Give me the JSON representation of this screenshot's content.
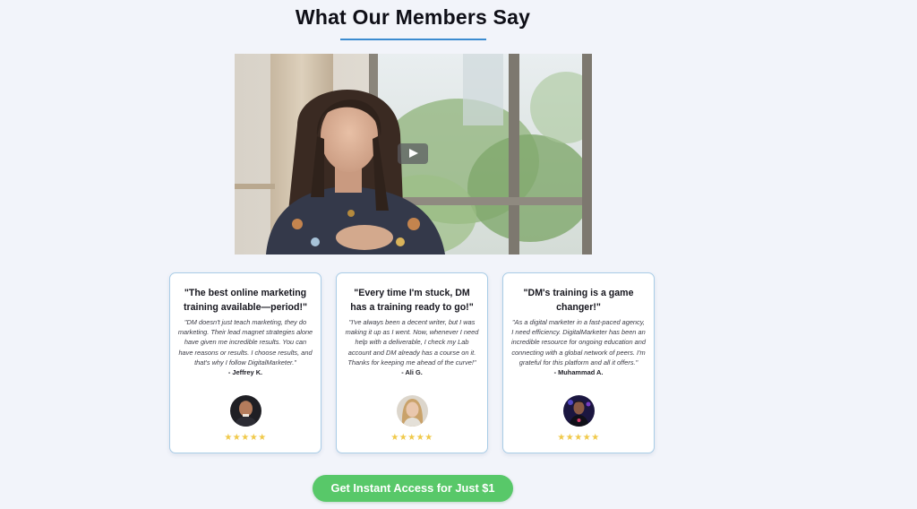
{
  "section": {
    "title": "What Our Members Say"
  },
  "video": {
    "play_icon": "play-icon"
  },
  "testimonials": [
    {
      "headline": "\"The best online marketing training available—period!\"",
      "quote": "\"DM doesn't just teach marketing, they do marketing. Their lead magnet strategies alone have given me incredible results. You can have reasons or results. I choose results, and that's why I follow DigitalMarketer.\"",
      "author": "- Jeffrey K.",
      "stars": "★★★★★",
      "rating": 5
    },
    {
      "headline": "\"Every time I'm stuck, DM has a training ready to go!\"",
      "quote": "\"I've always been a decent writer, but I was making it up as I went. Now, whenever I need help with a deliverable, I check my Lab account and DM already has a course on it. Thanks for keeping me ahead of the curve!\"",
      "author": "- Ali G.",
      "stars": "★★★★★",
      "rating": 5
    },
    {
      "headline": "\"DM's training is a game changer!\"",
      "quote": "\"As a digital marketer in a fast-paced agency, I need efficiency. DigitalMarketer has been an incredible resource for ongoing education and connecting with a global network of peers. I'm grateful for this platform and all it offers.\"",
      "author": "- Muhammad A.",
      "stars": "★★★★★",
      "rating": 5
    }
  ],
  "cta": {
    "label": "Get Instant Access for Just $1"
  },
  "colors": {
    "accent_underline": "#3b8bd0",
    "card_border": "#a9cce6",
    "star": "#f0c94a",
    "cta": "#58c869",
    "background": "#f2f4fa"
  }
}
